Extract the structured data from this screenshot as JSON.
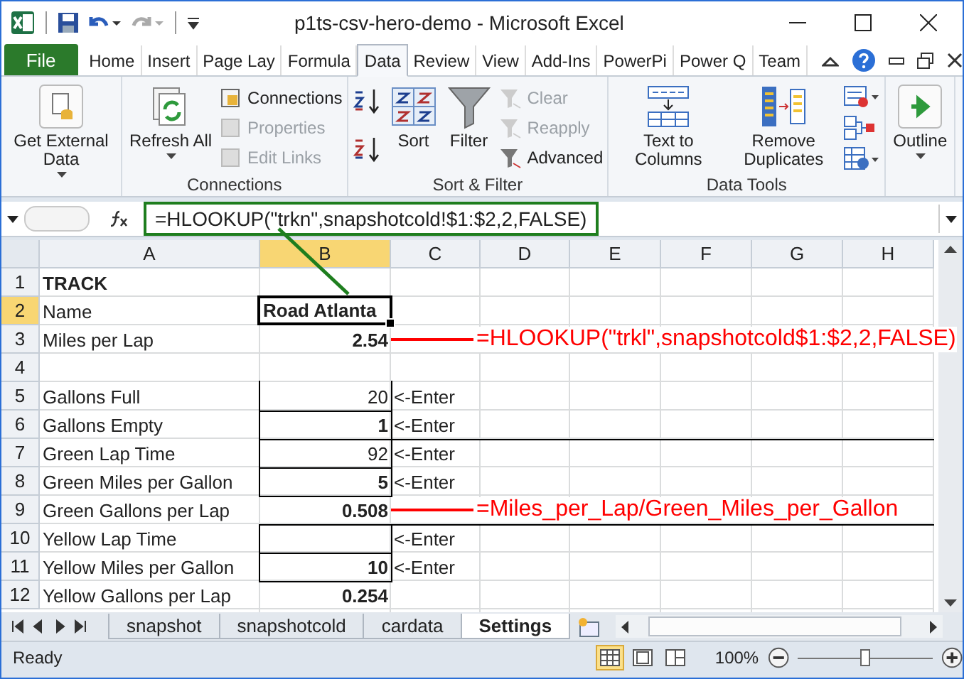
{
  "window": {
    "title": "p1ts-csv-hero-demo  -  Microsoft Excel"
  },
  "ribbon_tabs": [
    {
      "label": "File",
      "kind": "file",
      "selected": false
    },
    {
      "label": "Home",
      "kind": "tab",
      "selected": false
    },
    {
      "label": "Insert",
      "kind": "tab",
      "selected": false
    },
    {
      "label": "Page Lay",
      "kind": "tab",
      "selected": false
    },
    {
      "label": "Formula",
      "kind": "tab",
      "selected": false
    },
    {
      "label": "Data",
      "kind": "tab",
      "selected": true
    },
    {
      "label": "Review",
      "kind": "tab",
      "selected": false
    },
    {
      "label": "View",
      "kind": "tab",
      "selected": false
    },
    {
      "label": "Add-Ins",
      "kind": "tab",
      "selected": false
    },
    {
      "label": "PowerPi",
      "kind": "tab",
      "selected": false
    },
    {
      "label": "Power Q",
      "kind": "tab",
      "selected": false
    },
    {
      "label": "Team",
      "kind": "tab",
      "selected": false
    }
  ],
  "ribbon_groups": [
    {
      "items": [
        {
          "kind": "large",
          "label": "Get External Data",
          "dropdown": true
        }
      ]
    },
    {
      "label": "Connections",
      "items": [
        {
          "kind": "large",
          "label": "Refresh All",
          "dropdown": true
        },
        {
          "kind": "small",
          "label": "Connections",
          "disabled": false
        },
        {
          "kind": "small",
          "label": "Properties",
          "disabled": true
        },
        {
          "kind": "small",
          "label": "Edit Links",
          "disabled": true
        }
      ]
    },
    {
      "label": "Sort & Filter",
      "items": [
        {
          "kind": "sortpair"
        },
        {
          "kind": "large",
          "label": "Sort",
          "dropdown": false
        },
        {
          "kind": "large",
          "label": "Filter",
          "dropdown": false
        },
        {
          "kind": "small",
          "label": "Clear",
          "disabled": true
        },
        {
          "kind": "small",
          "label": "Reapply",
          "disabled": true
        },
        {
          "kind": "small",
          "label": "Advanced",
          "disabled": false
        }
      ]
    },
    {
      "label": "Data Tools",
      "items": [
        {
          "kind": "large",
          "label": "Text to Columns",
          "dropdown": false
        },
        {
          "kind": "large",
          "label": "Remove Duplicates",
          "dropdown": false
        },
        {
          "kind": "iconstack"
        }
      ]
    },
    {
      "items": [
        {
          "kind": "large",
          "label": "Outline",
          "dropdown": true
        }
      ]
    }
  ],
  "formula_bar": {
    "formula": "=HLOOKUP(\"trkn\",snapshotcold!$1:$2,2,FALSE)"
  },
  "columns": [
    "A",
    "B",
    "C",
    "D",
    "E",
    "F",
    "G",
    "H"
  ],
  "rows": [
    {
      "number": "1",
      "cells": [
        {
          "text": "TRACK",
          "kind": "text",
          "bold": true
        }
      ]
    },
    {
      "number": "2",
      "cells": [
        {
          "text": "Name",
          "kind": "text"
        },
        {
          "text": "Road Atlanta",
          "kind": "text",
          "bold": true,
          "selected": true
        }
      ]
    },
    {
      "number": "3",
      "cells": [
        {
          "text": "Miles per Lap",
          "kind": "text"
        },
        {
          "text": "2.54",
          "kind": "number",
          "bold": true,
          "note": {
            "text": "=HLOOKUP(\"trkl\",snapshotcold$1:$2,2,FALSE)",
            "color": "#ff0000"
          }
        }
      ]
    },
    {
      "number": "4",
      "cells": []
    },
    {
      "number": "5",
      "cells": [
        {
          "text": "Gallons Full",
          "kind": "text"
        },
        {
          "text": "20",
          "kind": "number",
          "boxed": true
        },
        {
          "text": "<-Enter",
          "kind": "text"
        }
      ]
    },
    {
      "number": "6",
      "cells": [
        {
          "text": "Gallons Empty",
          "kind": "text"
        },
        {
          "text": "1",
          "kind": "number",
          "bold": true,
          "boxed": true
        },
        {
          "text": "<-Enter",
          "kind": "text"
        }
      ]
    },
    {
      "number": "7",
      "rule_above": true,
      "cells": [
        {
          "text": "Green Lap Time",
          "kind": "text"
        },
        {
          "text": "92",
          "kind": "number",
          "boxed": true
        },
        {
          "text": "<-Enter",
          "kind": "text"
        }
      ]
    },
    {
      "number": "8",
      "cells": [
        {
          "text": "Green Miles per Gallon",
          "kind": "text"
        },
        {
          "text": "5",
          "kind": "number",
          "bold": true,
          "boxed": true
        },
        {
          "text": "<-Enter",
          "kind": "text"
        }
      ]
    },
    {
      "number": "9",
      "cells": [
        {
          "text": "Green Gallons per Lap",
          "kind": "text"
        },
        {
          "text": "0.508",
          "kind": "number",
          "bold": true,
          "note": {
            "text": "=Miles_per_Lap/Green_Miles_per_Gallon",
            "color": "#ff0000"
          }
        }
      ]
    },
    {
      "number": "10",
      "rule_above": true,
      "cells": [
        {
          "text": "Yellow Lap Time",
          "kind": "text"
        },
        {
          "kind": "number",
          "boxed": true
        },
        {
          "text": "<-Enter",
          "kind": "text"
        }
      ]
    },
    {
      "number": "11",
      "cells": [
        {
          "text": "Yellow Miles per Gallon",
          "kind": "text"
        },
        {
          "text": "10",
          "kind": "number",
          "bold": true,
          "boxed": true
        },
        {
          "text": "<-Enter",
          "kind": "text"
        }
      ]
    },
    {
      "number": "12",
      "cells": [
        {
          "text": "Yellow Gallons per Lap",
          "kind": "text"
        },
        {
          "text": "0.254",
          "kind": "number",
          "bold": true
        }
      ]
    }
  ],
  "sheet_tabs": [
    {
      "label": "snapshot",
      "selected": false
    },
    {
      "label": "snapshotcold",
      "selected": false
    },
    {
      "label": "cardata",
      "selected": false
    },
    {
      "label": "Settings",
      "selected": true
    }
  ],
  "status_bar": {
    "status": "Ready",
    "views": [
      {
        "selected": true
      },
      {
        "selected": false
      },
      {
        "selected": false
      }
    ],
    "zoom": "100%",
    "zoom_slider": {
      "level": 0.5
    }
  }
}
